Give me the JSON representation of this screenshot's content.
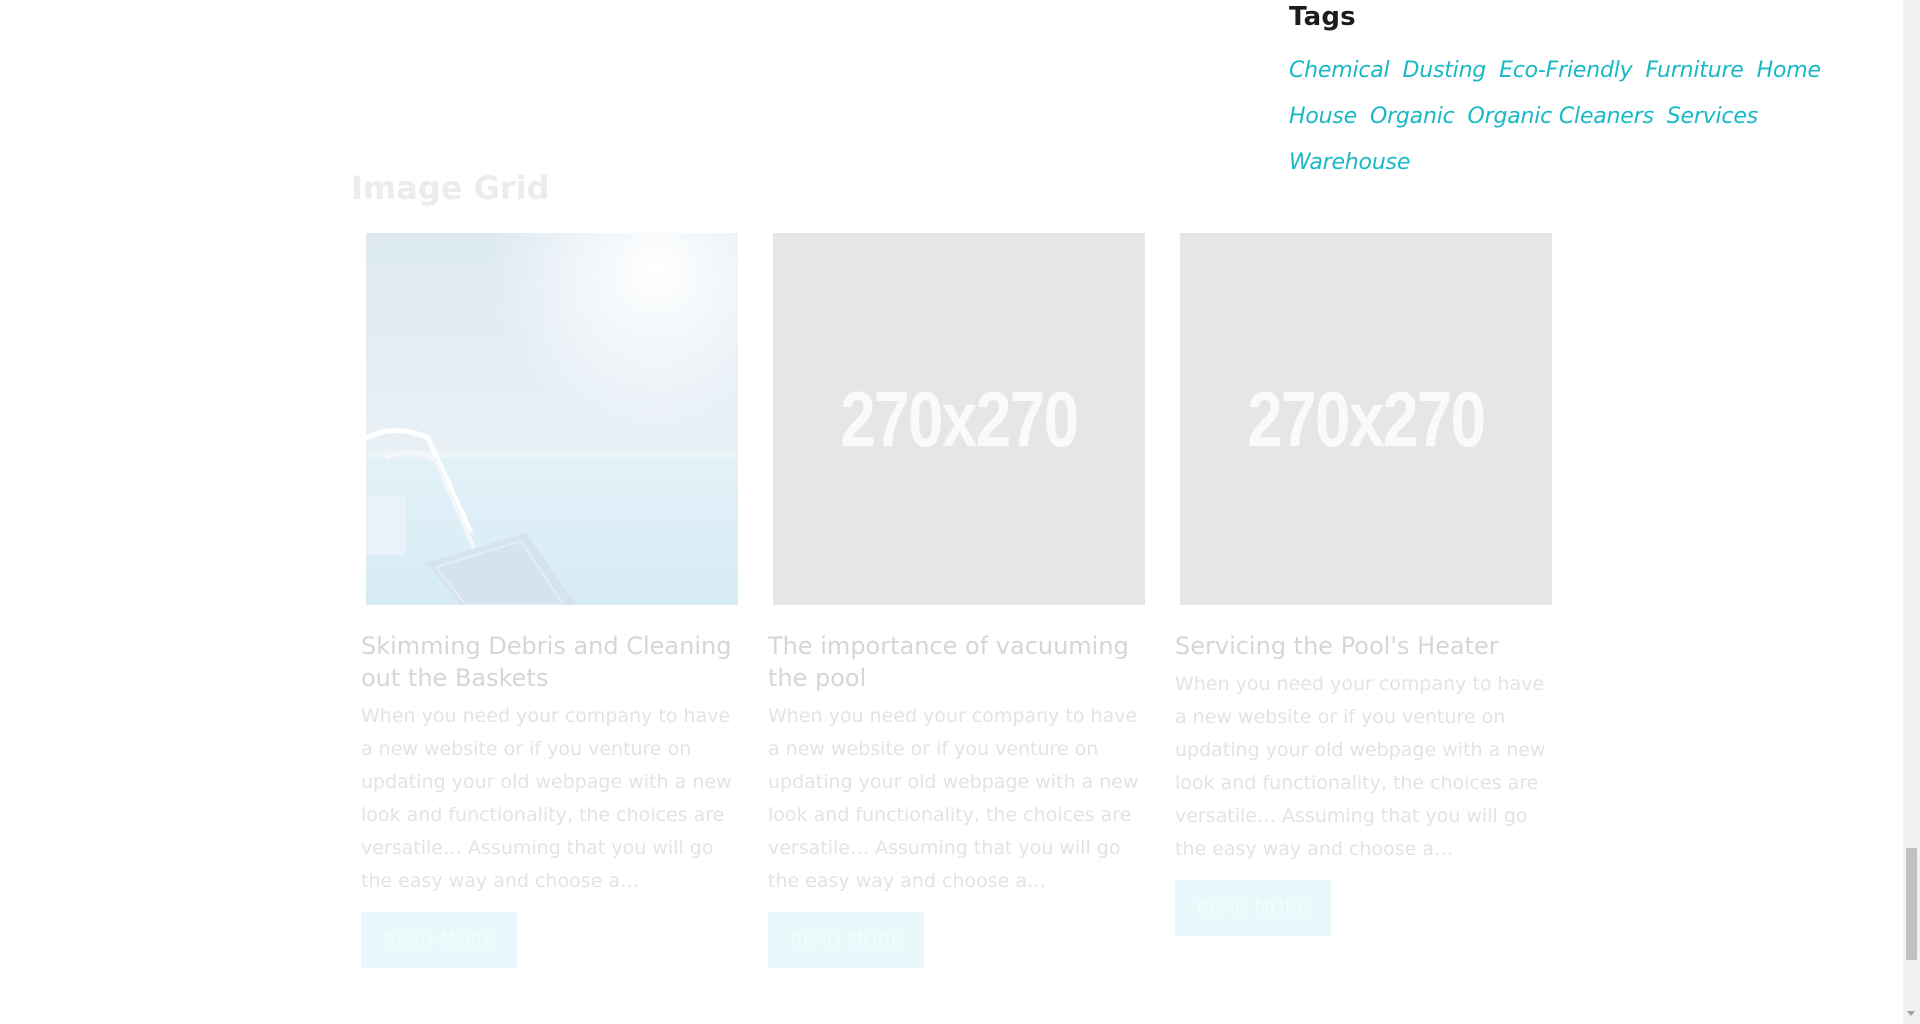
{
  "tags_widget": {
    "title": "Tags",
    "tags": [
      "Chemical",
      "Dusting",
      "Eco-Friendly",
      "Furniture",
      "Home",
      "House",
      "Organic",
      "Organic Cleaners",
      "Services",
      "Warehouse"
    ]
  },
  "image_grid": {
    "title": "Image Grid",
    "cards": [
      {
        "image": "pool-photo",
        "title": "Skimming Debris and Cleaning out the Baskets",
        "excerpt": "When you need your company to have a new website or if you venture on updating your old webpage with a new look and functionality, the choices are versatile… Assuming that you will go the easy way and choose a…",
        "button": "READ MORE"
      },
      {
        "image": "placeholder",
        "placeholder_text": "270x270",
        "title": "The importance of vacuuming the pool",
        "excerpt": "When you need your company to have a new website or if you venture on updating your old webpage with a new look and functionality, the choices are versatile… Assuming that you will go the easy way and choose a…",
        "button": "READ MORE"
      },
      {
        "image": "placeholder",
        "placeholder_text": "270x270",
        "title": "Servicing the Pool's Heater",
        "excerpt": "When you need your company to have a new website or if you venture on updating your old webpage with a new look and functionality, the choices are versatile… Assuming that you will go the easy way and choose a…",
        "button": "READ MORE"
      }
    ]
  },
  "colors": {
    "tag_link": "#19b8c7",
    "heading": "#1c1c1c",
    "faded_text": "#d6d6d6",
    "button_bg": "#e9f8fa"
  }
}
